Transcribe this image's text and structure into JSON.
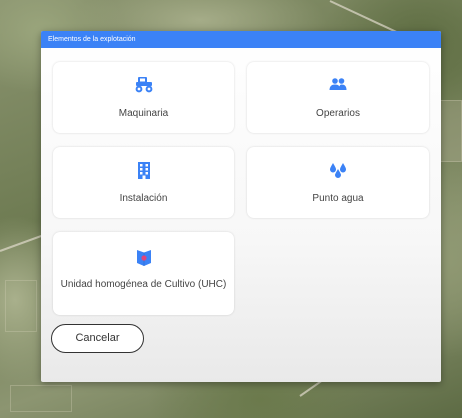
{
  "dialog": {
    "title": "Elementos de la explotación",
    "accent_color": "#3b82f6",
    "tiles": [
      {
        "label": "Maquinaria",
        "icon": "tractor-icon"
      },
      {
        "label": "Operarios",
        "icon": "people-icon"
      },
      {
        "label": "Instalación",
        "icon": "building-icon"
      },
      {
        "label": "Punto agua",
        "icon": "water-drops-icon"
      },
      {
        "label": "Unidad homogénea de Cultivo (UHC)",
        "icon": "parcel-map-icon"
      }
    ],
    "cancel_label": "Cancelar"
  }
}
